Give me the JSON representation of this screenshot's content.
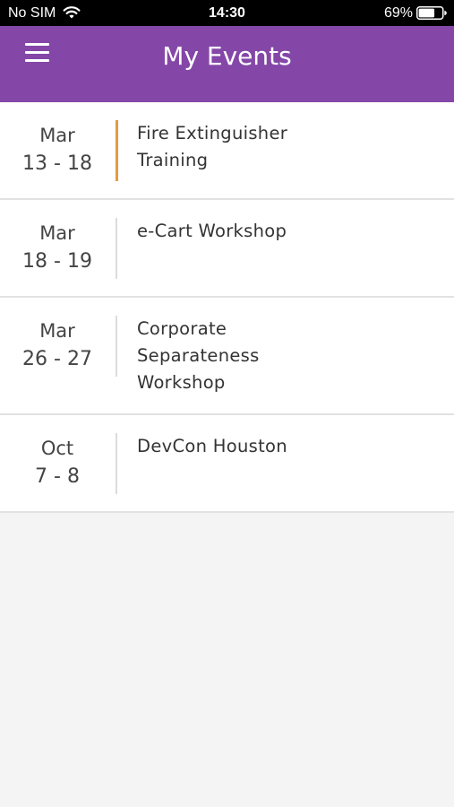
{
  "status_bar": {
    "carrier": "No SIM",
    "time": "14:30",
    "battery": "69%",
    "battery_level": 0.69
  },
  "header": {
    "title": "My Events",
    "menu_icon": "hamburger-menu-icon",
    "background_color": "#8447a8"
  },
  "events": [
    {
      "month": "Mar",
      "days": "13 - 18",
      "title": "Fire Extinguisher Training",
      "active": true
    },
    {
      "month": "Mar",
      "days": "18 - 19",
      "title": "e-Cart Workshop",
      "active": false
    },
    {
      "month": "Mar",
      "days": "26 - 27",
      "title": "Corporate Separateness Workshop",
      "active": false
    },
    {
      "month": "Oct",
      "days": "7 - 8",
      "title": "DevCon Houston",
      "active": false
    }
  ],
  "colors": {
    "accent": "#e49b3e",
    "divider": "#dcdcdc"
  }
}
